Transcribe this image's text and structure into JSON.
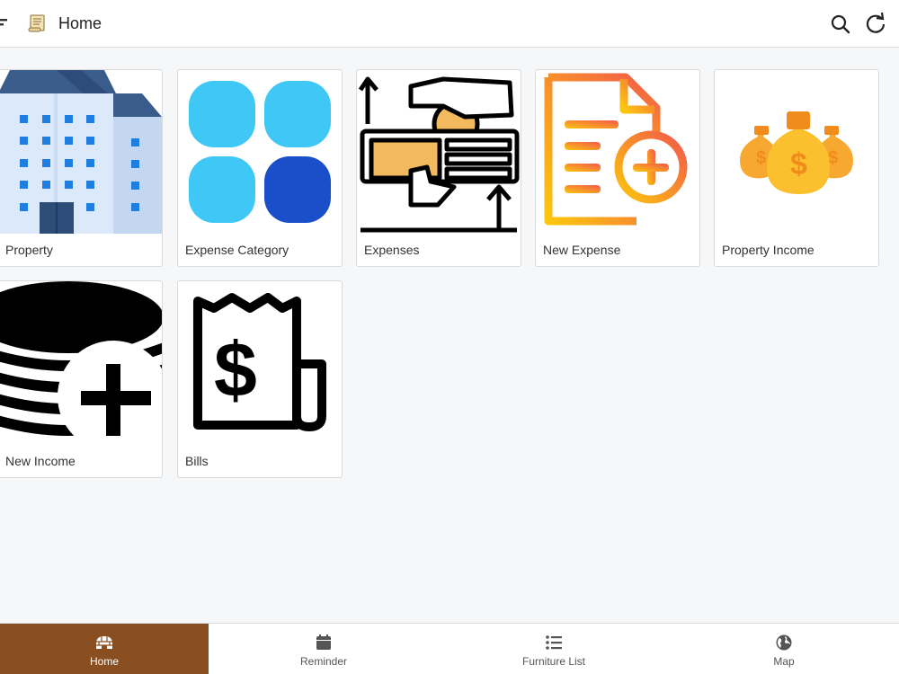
{
  "app_bar": {
    "title": "Home",
    "menu_icon": "hamburger-icon",
    "logo_icon": "scroll-icon",
    "actions": [
      "search-icon",
      "refresh-icon"
    ]
  },
  "tiles": [
    {
      "label": "Property",
      "icon": "building-icon"
    },
    {
      "label": "Expense Category",
      "icon": "category-grid-icon"
    },
    {
      "label": "Expenses",
      "icon": "money-hand-icon"
    },
    {
      "label": "New Expense",
      "icon": "document-plus-icon"
    },
    {
      "label": "Property Income",
      "icon": "money-bags-icon"
    },
    {
      "label": "New Income",
      "icon": "coins-plus-icon"
    },
    {
      "label": "Bills",
      "icon": "receipt-dollar-icon"
    }
  ],
  "bottom_nav": {
    "active_color": "#8a4f20",
    "items": [
      {
        "label": "Home",
        "icon": "igloo-icon",
        "active": true
      },
      {
        "label": "Reminder",
        "icon": "calendar-icon",
        "active": false
      },
      {
        "label": "Furniture List",
        "icon": "list-icon",
        "active": false
      },
      {
        "label": "Map",
        "icon": "globe-icon",
        "active": false
      }
    ]
  }
}
